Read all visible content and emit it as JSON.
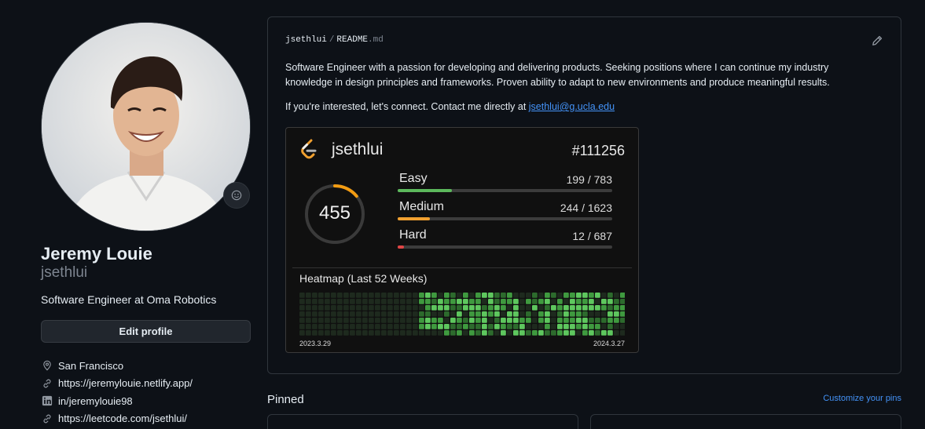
{
  "profile": {
    "full_name": "Jeremy Louie",
    "username": "jsethlui",
    "bio": "Software Engineer at Oma Robotics",
    "edit_button": "Edit profile",
    "details": [
      {
        "icon": "location-icon",
        "text": "San Francisco"
      },
      {
        "icon": "link-icon",
        "text": "https://jeremylouie.netlify.app/"
      },
      {
        "icon": "linkedin-icon",
        "text": "in/jeremylouie98"
      },
      {
        "icon": "link-icon",
        "text": "https://leetcode.com/jsethlui/"
      }
    ]
  },
  "readme": {
    "owner": "jsethlui",
    "separator": "/",
    "file": "README",
    "ext": ".md",
    "paragraph1": "Software Engineer with a passion for developing and delivering products. Seeking positions where I can continue my industry knowledge in design principles and frameworks. Proven ability to adapt to new environments and produce meaningful results.",
    "paragraph2_prefix": "If you're interested, let's connect. Contact me directly at ",
    "email": "jsethlui@g.ucla.edu"
  },
  "leetcode": {
    "username": "jsethlui",
    "rank": "#111256",
    "total_solved": "455",
    "total_fraction": 0.14,
    "rows": [
      {
        "label": "Easy",
        "value": "199 / 783",
        "fraction": 0.254,
        "color": "#5cb85c"
      },
      {
        "label": "Medium",
        "value": "244 / 1623",
        "fraction": 0.15,
        "color": "#f0a030"
      },
      {
        "label": "Hard",
        "value": "12 / 687",
        "fraction": 0.03,
        "color": "#e04545"
      }
    ],
    "heatmap_title": "Heatmap (Last 52 Weeks)",
    "heatmap_start": "2023.3.29",
    "heatmap_end": "2024.3.27",
    "colors": {
      "ring": "#f39c12",
      "empty_cell": "#1e2a1e",
      "active_low": "#2d6b2d",
      "active_mid": "#3f9a3f",
      "active_high": "#5ec75e"
    }
  },
  "pinned": {
    "title": "Pinned",
    "customize": "Customize your pins"
  },
  "colors": {
    "accent_link": "#4493f8",
    "background": "#0d1117",
    "border": "#30363d"
  }
}
